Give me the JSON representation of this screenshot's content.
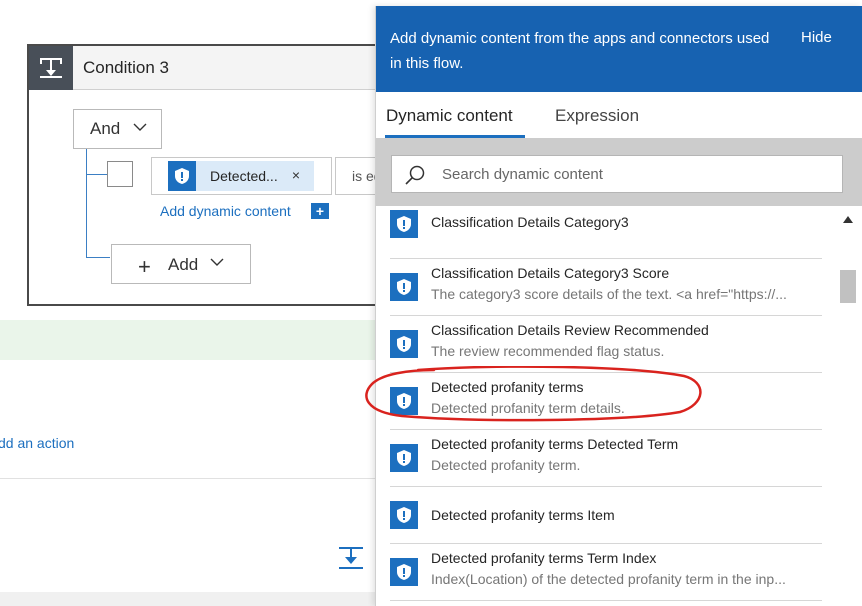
{
  "condition": {
    "title": "Condition 3",
    "logic_operator": "And",
    "token_label": "Detected...",
    "token_remove": "×",
    "operator_value": "is equal to",
    "add_dynamic_link": "Add dynamic content",
    "add_dynamic_badge": "+",
    "add_button_label": "Add"
  },
  "canvas": {
    "add_action_link": "dd an action"
  },
  "panel": {
    "header_text": "Add dynamic content from the apps and connectors used in this flow.",
    "hide_label": "Hide",
    "tabs": [
      {
        "label": "Dynamic content",
        "active": true
      },
      {
        "label": "Expression",
        "active": false
      }
    ],
    "search_placeholder": "Search dynamic content",
    "items": [
      {
        "title": "Classification Details Category3",
        "desc": ""
      },
      {
        "title": "Classification Details Category3 Score",
        "desc": "The category3 score details of the text. <a href=\"https://..."
      },
      {
        "title": "Classification Details Review Recommended",
        "desc": "The review recommended flag status."
      },
      {
        "title": "Detected profanity terms",
        "desc": "Detected profanity term details.",
        "highlighted": true
      },
      {
        "title": "Detected profanity terms Detected Term",
        "desc": "Detected profanity term."
      },
      {
        "title": "Detected profanity terms Item",
        "desc": ""
      },
      {
        "title": "Detected profanity terms Term Index",
        "desc": "Index(Location) of the detected profanity term in the inp..."
      }
    ]
  },
  "colors": {
    "panel_header": "#1762b1",
    "accent": "#1c6fbf",
    "highlight_circle": "#d9231e",
    "search_band": "#cccccc"
  },
  "icons": {
    "condition": "condition-branch-icon",
    "connector": "shield-exclamation-icon",
    "search": "search-icon",
    "insert": "insert-step-icon"
  }
}
